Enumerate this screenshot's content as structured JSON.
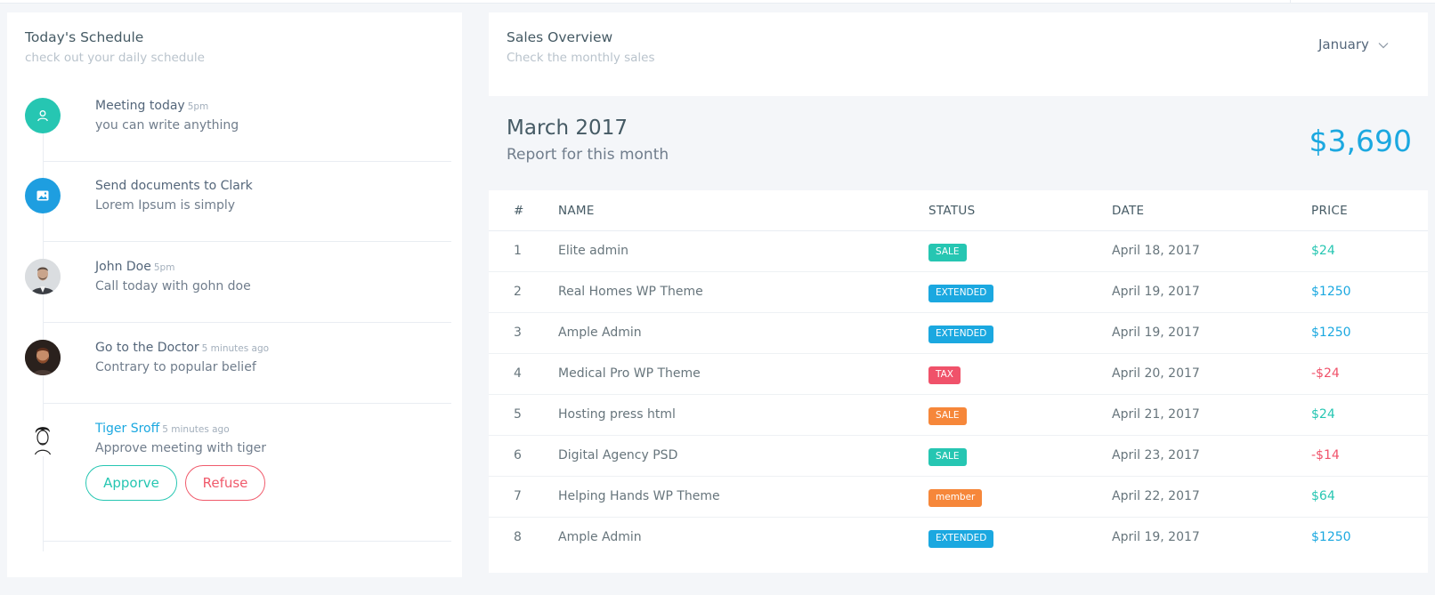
{
  "schedule": {
    "title": "Today's Schedule",
    "subtitle": "check out your daily schedule",
    "items": [
      {
        "title": "Meeting today",
        "time": "5pm",
        "desc": "you can write anything",
        "icon": "user-icon",
        "color": "#26c6b2"
      },
      {
        "title": "Send documents to Clark",
        "time": "",
        "desc": "Lorem Ipsum is simply",
        "icon": "image-icon",
        "color": "#1e9ee0"
      },
      {
        "title": "John Doe",
        "time": "5pm",
        "desc": "Call today with gohn doe",
        "icon": "avatar-john",
        "color": "#d6d9dc"
      },
      {
        "title": "Go to the Doctor",
        "time": "5 minutes ago",
        "desc": "Contrary to popular belief",
        "icon": "avatar-doctor",
        "color": "#3a2a24"
      },
      {
        "title": "Tiger Sroff",
        "time": "5 minutes ago",
        "desc": "Approve meeting with tiger",
        "icon": "avatar-tiger",
        "color": "#ffffff"
      }
    ],
    "approve_label": "Apporve",
    "refuse_label": "Refuse"
  },
  "sales": {
    "title": "Sales Overview",
    "subtitle": "Check the monthly sales",
    "month": "January",
    "report_title": "March 2017",
    "report_sub": "Report for this month",
    "total": "$3,690",
    "headers": [
      "#",
      "NAME",
      "STATUS",
      "DATE",
      "PRICE"
    ],
    "rows": [
      {
        "num": "1",
        "name": "Elite admin",
        "status": "SALE",
        "status_color": "#26c6b2",
        "date": "April 18, 2017",
        "price": "$24",
        "price_color": "#26c6b2"
      },
      {
        "num": "2",
        "name": "Real Homes WP Theme",
        "status": "EXTENDED",
        "status_color": "#1ba8e0",
        "date": "April 19, 2017",
        "price": "$1250",
        "price_color": "#1ba8e0"
      },
      {
        "num": "3",
        "name": "Ample Admin",
        "status": "EXTENDED",
        "status_color": "#1ba8e0",
        "date": "April 19, 2017",
        "price": "$1250",
        "price_color": "#1ba8e0"
      },
      {
        "num": "4",
        "name": "Medical Pro WP Theme",
        "status": "TAX",
        "status_color": "#f0526a",
        "date": "April 20, 2017",
        "price": "-$24",
        "price_color": "#f0526a"
      },
      {
        "num": "5",
        "name": "Hosting press html",
        "status": "SALE",
        "status_color": "#f6873a",
        "date": "April 21, 2017",
        "price": "$24",
        "price_color": "#26c6b2"
      },
      {
        "num": "6",
        "name": "Digital Agency PSD",
        "status": "SALE",
        "status_color": "#26c6b2",
        "date": "April 23, 2017",
        "price": "-$14",
        "price_color": "#f0526a"
      },
      {
        "num": "7",
        "name": "Helping Hands WP Theme",
        "status": "member",
        "status_color": "#f6873a",
        "date": "April 22, 2017",
        "price": "$64",
        "price_color": "#26c6b2"
      },
      {
        "num": "8",
        "name": "Ample Admin",
        "status": "EXTENDED",
        "status_color": "#1ba8e0",
        "date": "April 19, 2017",
        "price": "$1250",
        "price_color": "#1ba8e0"
      }
    ]
  }
}
